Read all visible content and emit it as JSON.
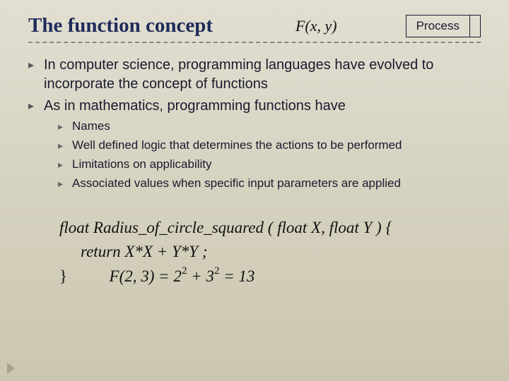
{
  "header": {
    "title": "The function concept",
    "fxy": "F(x, y)",
    "process": "Process"
  },
  "bullets": [
    "In computer science, programming languages have evolved to incorporate the concept of functions",
    "As in mathematics, programming functions have"
  ],
  "subbullets": [
    "Names",
    "Well defined logic that determines the actions to be performed",
    "Limitations on applicability",
    "Associated values when specific input parameters are applied"
  ],
  "math": {
    "l1": "float Radius_of_circle_squared ( float X, float Y ) {",
    "l2": "return X*X + Y*Y ;",
    "l3a": "}",
    "l3b_pre": "F(2, 3)   =   2",
    "l3b_mid": "  +  3",
    "l3b_post": "  =   13",
    "exp": "2"
  }
}
